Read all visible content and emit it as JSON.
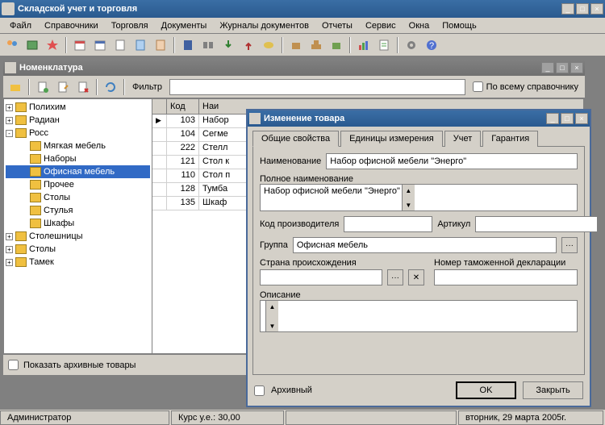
{
  "window": {
    "title": "Складской учет и торговля"
  },
  "menu": [
    "Файл",
    "Справочники",
    "Торговля",
    "Документы",
    "Журналы документов",
    "Отчеты",
    "Сервис",
    "Окна",
    "Помощь"
  ],
  "nomenclature": {
    "title": "Номенклатура",
    "filter_label": "Фильтр",
    "all_ref_label": "По всему справочнику",
    "show_archived": "Показать архивные товары",
    "tree": [
      {
        "label": "Полихим",
        "level": 0,
        "exp": "+"
      },
      {
        "label": "Радиан",
        "level": 0,
        "exp": "+"
      },
      {
        "label": "Росс",
        "level": 0,
        "exp": "-"
      },
      {
        "label": "Мягкая мебель",
        "level": 1
      },
      {
        "label": "Наборы",
        "level": 1
      },
      {
        "label": "Офисная мебель",
        "level": 1,
        "selected": true
      },
      {
        "label": "Прочее",
        "level": 1
      },
      {
        "label": "Столы",
        "level": 1
      },
      {
        "label": "Стулья",
        "level": 1
      },
      {
        "label": "Шкафы",
        "level": 1
      },
      {
        "label": "Столешницы",
        "level": 0,
        "exp": "+"
      },
      {
        "label": "Столы",
        "level": 0,
        "exp": "+"
      },
      {
        "label": "Тамек",
        "level": 0,
        "exp": "+"
      }
    ],
    "columns": {
      "code": "Код",
      "name": "Наи"
    },
    "rows": [
      {
        "code": "103",
        "name": "Набор",
        "ptr": true
      },
      {
        "code": "104",
        "name": "Сегме"
      },
      {
        "code": "222",
        "name": "Стелл"
      },
      {
        "code": "121",
        "name": "Стол к"
      },
      {
        "code": "110",
        "name": "Стол п"
      },
      {
        "code": "128",
        "name": "Тумба"
      },
      {
        "code": "135",
        "name": "Шкаф"
      }
    ]
  },
  "edit": {
    "title": "Изменение товара",
    "tabs": [
      "Общие свойства",
      "Единицы измерения",
      "Учет",
      "Гарантия"
    ],
    "labels": {
      "name": "Наименование",
      "full_name": "Полное наименование",
      "mfr_code": "Код производителя",
      "article": "Артикул",
      "group": "Группа",
      "origin": "Страна происхождения",
      "customs": "Номер таможенной декларации",
      "description": "Описание",
      "archived": "Архивный"
    },
    "values": {
      "name": "Набор офисной мебели \"Энерго\"",
      "full_name": "Набор офисной мебели \"Энерго\"",
      "group": "Офисная мебель"
    },
    "buttons": {
      "ok": "OK",
      "close": "Закрыть"
    }
  },
  "status": {
    "user": "Администратор",
    "rate": "Курс у.е.: 30,00",
    "date": "вторник, 29 марта 2005г."
  }
}
